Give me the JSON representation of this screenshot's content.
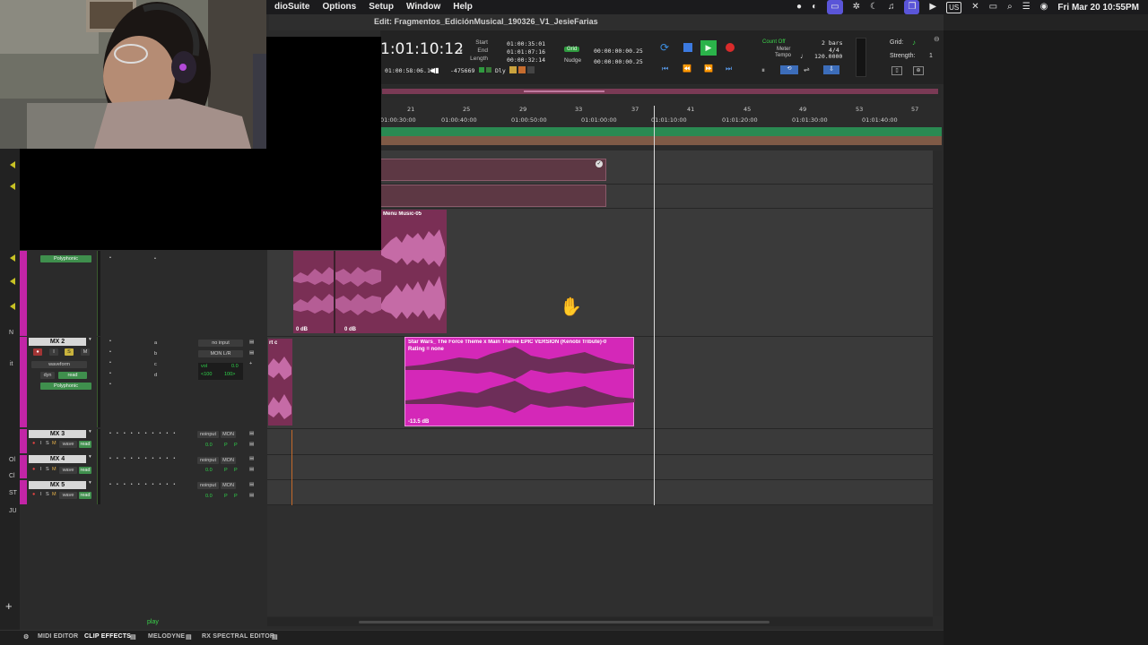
{
  "menubar": {
    "menus": [
      "dioSuite",
      "Options",
      "Setup",
      "Window",
      "Help"
    ],
    "input_source": "US",
    "clock": "Fri Mar 20  10:55PM"
  },
  "window": {
    "title": "Edit: Fragmentos_EdiciónMusical_190326_V1_JesieFarias"
  },
  "transport": {
    "main_counter": "1:01:10:12",
    "start_label": "Start",
    "end_label": "End",
    "length_label": "Length",
    "start_value": "01:00:35:01",
    "end_value": "01:01:07:16",
    "length_value": "00:00:32:14",
    "pre_roll": "01:00:58:06.10",
    "offset": "-475669",
    "dly_label": "Dly",
    "grid_label": "Grid",
    "nudge_label": "Nudge",
    "grid_value": "00:00:00:00.25",
    "nudge_value": "00:00:00:00.25",
    "count_off": "Count Off",
    "meter_label": "Meter",
    "tempo_label": "Tempo",
    "count_off_value": "2 bars",
    "meter_value": "4/4",
    "tempo_value": "120.0000",
    "grid_right_label": "Grid:",
    "strength_label": "Strength:",
    "strength_value": "1"
  },
  "bar_ruler": [
    "21",
    "25",
    "29",
    "33",
    "37",
    "41",
    "45",
    "49",
    "53",
    "57"
  ],
  "time_ruler": [
    "01:00:30:00",
    "01:00:40:00",
    "01:00:50:00",
    "01:01:00:00",
    "01:01:10:00",
    "01:01:20:00",
    "01:01:30:00",
    "01:01:40:00"
  ],
  "clips": {
    "menu_music": {
      "title": "Menu Music-05",
      "gain_left": "0 dB",
      "gain_right": "0 dB"
    },
    "partial": {
      "title": "rt c"
    },
    "star_wars": {
      "title": "Star Wars_ The Force Theme x Main Theme  EPIC VERSION (Kenobi Tribute)-0",
      "rating": "Rating = none",
      "gain": "-13.5 dB"
    }
  },
  "tracks": {
    "mx1": {
      "playlist_mode": "Polyphonic"
    },
    "mx2": {
      "name": "MX 2",
      "input": "no input",
      "output": "MON L/R",
      "view": "waveform",
      "dyn": "dyn",
      "read": "read",
      "playlist_mode": "Polyphonic",
      "vol_label": "vol",
      "vol_value": "0.0",
      "pan_left": "<100",
      "pan_right": "100>",
      "sends": [
        "a",
        "b",
        "c",
        "d"
      ]
    },
    "mx3": {
      "name": "MX 3",
      "input": "noinput",
      "output": "MON",
      "view": "wave",
      "read": "read",
      "vol": "0.0",
      "p": "P"
    },
    "mx4": {
      "name": "MX 4",
      "input": "noinput",
      "output": "MON",
      "view": "wave",
      "read": "read",
      "vol": "0.0",
      "p": "P"
    },
    "mx5": {
      "name": "MX 5",
      "input": "noinput",
      "output": "MON",
      "view": "wave",
      "read": "read",
      "vol": "0.0",
      "p": "P"
    },
    "buttons": {
      "i": "I",
      "s": "S",
      "m": "M",
      "rec": "●"
    }
  },
  "bottom_tabs": [
    "MIDI EDITOR",
    "CLIP EFFECTS",
    "MELODYNE",
    "RX SPECTRAL EDITOR"
  ],
  "status": {
    "play": "play"
  },
  "left_strip_letters": [
    "N",
    "it",
    "Ol",
    "Cl",
    "ST",
    "JU"
  ],
  "colors": {
    "track": "#c225a6",
    "clip_pink": "#d428b8",
    "clip_dark": "#7a2f55",
    "green": "#2f9a3f",
    "record": "#d92b2b"
  }
}
